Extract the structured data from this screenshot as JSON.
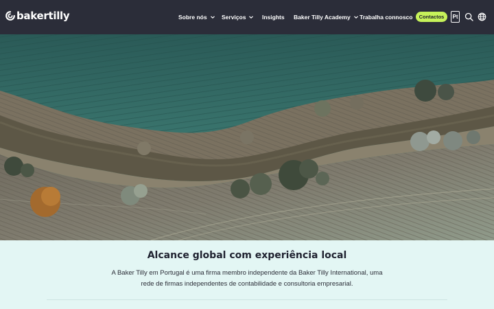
{
  "brand": {
    "name": "bakertilly",
    "logo_icon": "bakertilly-swirl-icon"
  },
  "nav": {
    "items": [
      {
        "label": "Sobre nós",
        "has_dropdown": true
      },
      {
        "label": "Serviços",
        "has_dropdown": true
      },
      {
        "label": "Insights",
        "has_dropdown": false
      },
      {
        "label": "Baker Tilly Academy",
        "has_dropdown": true
      },
      {
        "label": "Trabalha connosco",
        "has_dropdown": true
      }
    ],
    "cta_label": "Contactos",
    "language_label": "Pt",
    "search_icon": "search-icon",
    "globe_icon": "globe-icon"
  },
  "hero": {
    "image": "aerial view of a river between green fields"
  },
  "intro": {
    "title": "Alcance global com experiência local",
    "body": "A Baker Tilly em Portugal é uma firma membro independente da Baker Tilly International, uma rede de firmas independentes de contabilidade e consultoria empresarial."
  },
  "colors": {
    "header_bg": "#2b2d39",
    "cta_bg": "#c6f25a",
    "section_bg": "#e3f6f4",
    "text_dark": "#1f2230"
  }
}
